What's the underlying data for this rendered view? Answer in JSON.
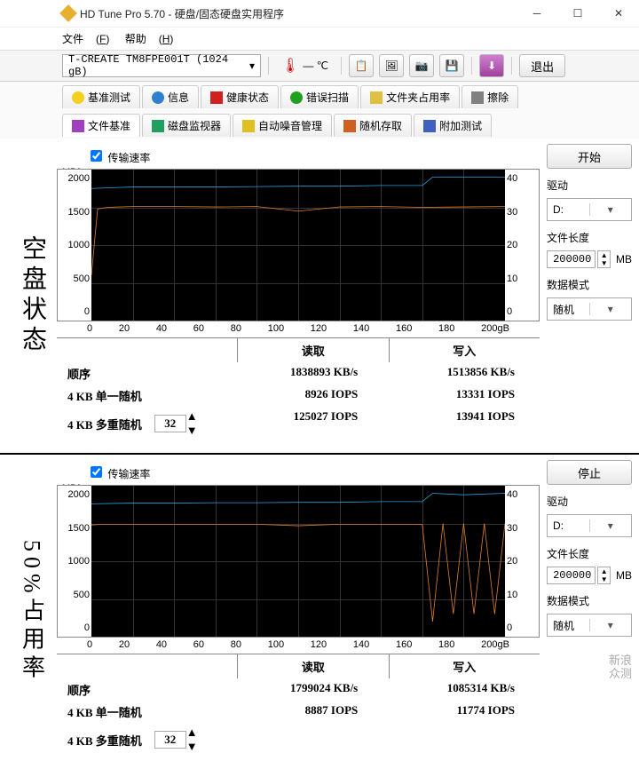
{
  "window": {
    "title": "HD Tune Pro 5.70 - 硬盘/固态硬盘实用程序"
  },
  "menu": {
    "file": "文件",
    "file_key": "F",
    "help": "帮助",
    "help_key": "H"
  },
  "toolbar": {
    "drive": "T-CREATE TM8FPE001T (1024 gB)",
    "temp_value": "— ℃",
    "exit": "退出"
  },
  "tabs": {
    "benchmark": "基准测试",
    "info": "信息",
    "health": "健康状态",
    "errorscan": "错误扫描",
    "folderusage": "文件夹占用率",
    "erase": "擦除",
    "filebm": "文件基准",
    "diskmon": "磁盘监视器",
    "aam": "自动噪音管理",
    "randomaccess": "随机存取",
    "extra": "附加测试"
  },
  "side": {
    "top": "空盘状态",
    "bot": "50%占用率"
  },
  "common": {
    "transfer_cb": "传输速率",
    "start": "开始",
    "stop": "停止",
    "drive_lbl": "驱动",
    "drive_val": "D:",
    "filelen_lbl": "文件长度",
    "filelen_val": "200000",
    "mb": "MB",
    "mode_lbl": "数据模式",
    "mode_val": "随机",
    "yl_unit": "MB/s",
    "yr_unit": "ms",
    "x_unit": "gB",
    "yl_ticks": [
      "2000",
      "1500",
      "1000",
      "500",
      "0"
    ],
    "yr_ticks": [
      "40",
      "30",
      "20",
      "10",
      "0"
    ],
    "x_ticks": [
      "0",
      "20",
      "40",
      "60",
      "80",
      "100",
      "120",
      "140",
      "160",
      "180",
      "200"
    ],
    "col_read": "读取",
    "col_write": "写入",
    "row_seq": "顺序",
    "row_4ks": "4 KB 单一随机",
    "row_4km": "4 KB 多重随机",
    "spin": "32"
  },
  "top_results": {
    "seq_read": "1838893 KB/s",
    "seq_write": "1513856 KB/s",
    "s_read": "8926 IOPS",
    "s_write": "13331 IOPS",
    "m_read": "125027 IOPS",
    "m_write": "13941 IOPS"
  },
  "bot_results": {
    "seq_read": "1799024 KB/s",
    "seq_write": "1085314 KB/s",
    "s_read": "8887 IOPS",
    "s_write": "11774 IOPS",
    "m_read": "",
    "m_write": ""
  },
  "watermark": {
    "l1": "新浪",
    "l2": "众测"
  },
  "chart_data": [
    {
      "type": "line",
      "title": "空盘状态",
      "xlabel": "gB",
      "ylabel": "MB/s",
      "y2label": "ms",
      "xlim": [
        0,
        200
      ],
      "ylim": [
        0,
        2000
      ],
      "y2lim": [
        0,
        40
      ],
      "series": [
        {
          "name": "read",
          "axis": "y",
          "color": "#2da0e0",
          "x": [
            0,
            10,
            20,
            40,
            60,
            80,
            100,
            120,
            140,
            160,
            165,
            180,
            200
          ],
          "y": [
            1750,
            1760,
            1770,
            1770,
            1770,
            1775,
            1780,
            1780,
            1790,
            1790,
            1900,
            1900,
            1900
          ]
        },
        {
          "name": "write",
          "axis": "y",
          "color": "#e08030",
          "x": [
            0,
            3,
            8,
            20,
            40,
            60,
            80,
            100,
            120,
            140,
            160,
            180,
            200
          ],
          "y": [
            600,
            1480,
            1500,
            1510,
            1510,
            1505,
            1510,
            1450,
            1505,
            1510,
            1500,
            1505,
            1510
          ]
        }
      ]
    },
    {
      "type": "line",
      "title": "50%占用率",
      "xlabel": "gB",
      "ylabel": "MB/s",
      "y2label": "ms",
      "xlim": [
        0,
        200
      ],
      "ylim": [
        0,
        2000
      ],
      "y2lim": [
        0,
        40
      ],
      "series": [
        {
          "name": "read",
          "axis": "y",
          "color": "#2da0e0",
          "x": [
            0,
            20,
            40,
            60,
            80,
            100,
            120,
            140,
            160,
            165,
            180,
            200
          ],
          "y": [
            1760,
            1770,
            1770,
            1775,
            1775,
            1780,
            1780,
            1790,
            1790,
            1900,
            1880,
            1900
          ]
        },
        {
          "name": "write",
          "axis": "y",
          "color": "#e08030",
          "x": [
            0,
            5,
            20,
            40,
            60,
            80,
            100,
            120,
            140,
            160,
            165,
            170,
            175,
            180,
            185,
            190,
            195,
            200
          ],
          "y": [
            1480,
            1490,
            1490,
            1490,
            1490,
            1490,
            1470,
            1490,
            1490,
            1490,
            200,
            1500,
            300,
            1500,
            300,
            1500,
            300,
            1500
          ]
        }
      ]
    }
  ]
}
